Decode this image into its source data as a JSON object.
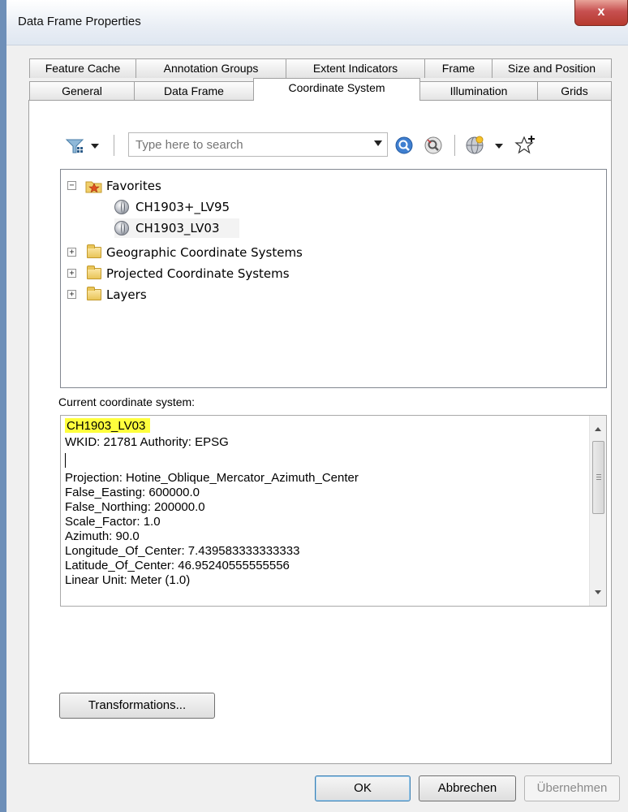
{
  "window": {
    "title": "Data Frame Properties",
    "close_label": "x"
  },
  "tabs": {
    "row1": [
      "Feature Cache",
      "Annotation Groups",
      "Extent Indicators",
      "Frame",
      "Size and Position"
    ],
    "row2": [
      "General",
      "Data Frame",
      "Coordinate System",
      "Illumination",
      "Grids"
    ],
    "active": "Coordinate System"
  },
  "toolbar": {
    "filter_icon": "filter-icon",
    "search_placeholder": "Type here to search",
    "search_icon": "search-icon",
    "clear_search_icon": "clear-search-icon",
    "globe_add_icon": "add-coordinate-system-icon",
    "favorite_icon": "add-to-favorites-icon"
  },
  "tree": {
    "favorites": {
      "label": "Favorites",
      "items": [
        "CH1903+_LV95",
        "CH1903_LV03"
      ]
    },
    "folders": [
      "Geographic Coordinate Systems",
      "Projected Coordinate Systems",
      "Layers"
    ],
    "selected": "CH1903_LV03"
  },
  "current": {
    "label": "Current coordinate system:",
    "name": "CH1903_LV03",
    "lines": [
      "WKID: 21781 Authority: EPSG",
      "Projection: Hotine_Oblique_Mercator_Azimuth_Center",
      "False_Easting: 600000.0",
      "False_Northing: 200000.0",
      "Scale_Factor: 1.0",
      "Azimuth: 90.0",
      "Longitude_Of_Center: 7.439583333333333",
      "Latitude_Of_Center: 46.95240555555556",
      "Linear Unit: Meter (1.0)"
    ]
  },
  "buttons": {
    "transformations": "Transformations...",
    "ok": "OK",
    "cancel": "Abbrechen",
    "apply": "Übernehmen"
  }
}
